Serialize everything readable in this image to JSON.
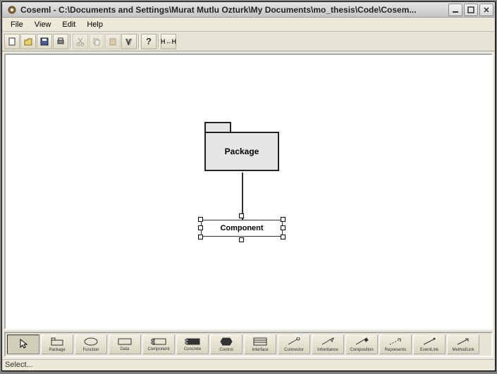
{
  "window": {
    "title": "Coseml - C:\\Documents and Settings\\Murat Mutlu Ozturk\\My Documents\\mo_thesis\\Code\\Cosem..."
  },
  "menubar": {
    "items": [
      "File",
      "View",
      "Edit",
      "Help"
    ]
  },
  "toolbar": {
    "buttons": [
      {
        "name": "new-icon"
      },
      {
        "name": "open-icon"
      },
      {
        "name": "save-icon"
      },
      {
        "name": "print-icon"
      },
      {
        "name": "cut-icon",
        "dim": true
      },
      {
        "name": "copy-icon",
        "dim": true
      },
      {
        "name": "paste-icon",
        "dim": true
      },
      {
        "name": "find-icon"
      },
      {
        "name": "help-icon"
      },
      {
        "name": "refresh-icon"
      }
    ]
  },
  "canvas": {
    "package_label": "Package",
    "component_label": "Component"
  },
  "palette": {
    "items": [
      {
        "name": "select-tool",
        "label": "",
        "selected": true
      },
      {
        "name": "package-tool",
        "label": "Package"
      },
      {
        "name": "function-tool",
        "label": "Function"
      },
      {
        "name": "data-tool",
        "label": "Data"
      },
      {
        "name": "component-tool",
        "label": "Component"
      },
      {
        "name": "concrete-tool",
        "label": "Concrete"
      },
      {
        "name": "control-tool",
        "label": "Control"
      },
      {
        "name": "interface-tool",
        "label": "Interface"
      },
      {
        "name": "connector-tool",
        "label": "Connector"
      },
      {
        "name": "inheritance-tool",
        "label": "Inheritance"
      },
      {
        "name": "composition-tool",
        "label": "Composition"
      },
      {
        "name": "represents-tool",
        "label": "Represents"
      },
      {
        "name": "eventlink-tool",
        "label": "EventLink"
      },
      {
        "name": "methodlink-tool",
        "label": "MethodLink"
      }
    ]
  },
  "statusbar": {
    "text": "Select..."
  }
}
